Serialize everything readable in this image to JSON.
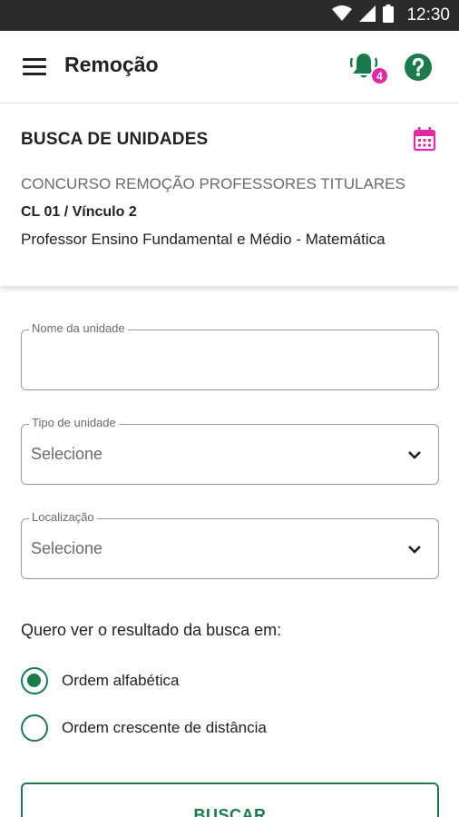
{
  "status_bar": {
    "time": "12:30"
  },
  "app_bar": {
    "title": "Remoção",
    "notification_count": "4"
  },
  "card": {
    "title": "BUSCA DE UNIDADES",
    "subtitle": "CONCURSO REMOÇÃO PROFESSORES TITULARES",
    "link": "CL 01 / Vínculo 2",
    "description": "Professor Ensino Fundamental e Médio - Matemática"
  },
  "form": {
    "nome": {
      "label": "Nome da unidade",
      "value": ""
    },
    "tipo": {
      "label": "Tipo de unidade",
      "value": "Selecione"
    },
    "localizacao": {
      "label": "Localização",
      "value": "Selecione"
    },
    "question": "Quero ver o resultado da busca em:",
    "options": [
      {
        "label": "Ordem alfabética",
        "selected": true
      },
      {
        "label": "Ordem crescente de distância",
        "selected": false
      }
    ],
    "submit_label": "BUSCAR"
  },
  "colors": {
    "primary": "#1b7a4c",
    "accent": "#e02aa6",
    "status_bar": "#2b2b2b"
  }
}
